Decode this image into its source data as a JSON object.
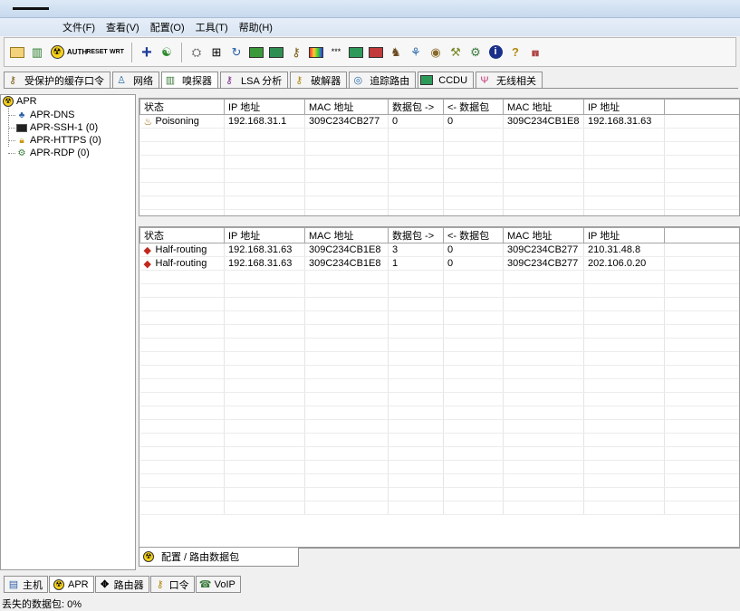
{
  "menu": [
    "文件(F)",
    "查看(V)",
    "配置(O)",
    "工具(T)",
    "帮助(H)"
  ],
  "toolbar": [
    "folder-icon",
    "network-card-icon",
    "nuclear-icon",
    "auth-icon",
    "reset-icon",
    "wrt-icon",
    "plus-icon",
    "globe-icon",
    "sniffer-icon",
    "route-icon",
    "refresh-icon",
    "chart-icon",
    "hash-icon",
    "lock-key-icon",
    "rainbow-icon",
    "dots-icon",
    "card-icon",
    "cpu-icon",
    "bucket-icon",
    "network-icon",
    "disc-icon",
    "tools-icon",
    "gear-icon",
    "info-icon",
    "help-icon",
    "tower-icon"
  ],
  "tabs": [
    {
      "label": "受保护的缓存口令",
      "icon": "key-user-icon"
    },
    {
      "label": "网络",
      "icon": "network-icon"
    },
    {
      "label": "嗅探器",
      "icon": "sniffer-icon"
    },
    {
      "label": "LSA 分析",
      "icon": "lsa-icon"
    },
    {
      "label": "破解器",
      "icon": "cracker-icon"
    },
    {
      "label": "追踪路由",
      "icon": "traceroute-icon"
    },
    {
      "label": "CCDU",
      "icon": "ccdu-icon"
    },
    {
      "label": "无线相关",
      "icon": "wireless-icon"
    }
  ],
  "active_tab_index": 2,
  "tree": {
    "root": "APR",
    "children": [
      "APR-DNS",
      "APR-SSH-1 (0)",
      "APR-HTTPS (0)",
      "APR-RDP (0)"
    ]
  },
  "grid_top": {
    "headers": [
      "状态",
      "IP 地址",
      "MAC 地址",
      "数据包 ->",
      "<- 数据包",
      "MAC 地址",
      "IP 地址",
      ""
    ],
    "rows": [
      [
        "Poisoning",
        "192.168.31.1",
        "309C234CB277",
        "0",
        "0",
        "309C234CB1E8",
        "192.168.31.63",
        ""
      ]
    ]
  },
  "grid_bottom": {
    "headers": [
      "状态",
      "IP 地址",
      "MAC 地址",
      "数据包 ->",
      "<- 数据包",
      "MAC 地址",
      "IP 地址",
      ""
    ],
    "rows": [
      [
        "Half-routing",
        "192.168.31.63",
        "309C234CB1E8",
        "3",
        "0",
        "309C234CB277",
        "210.31.48.8",
        ""
      ],
      [
        "Half-routing",
        "192.168.31.63",
        "309C234CB1E8",
        "1",
        "0",
        "309C234CB277",
        "202.106.0.20",
        ""
      ]
    ]
  },
  "subtab": "配置 / 路由数据包",
  "view_tabs": [
    {
      "label": "主机",
      "icon": "host-icon"
    },
    {
      "label": "APR",
      "icon": "apr-icon"
    },
    {
      "label": "路由器",
      "icon": "router-icon"
    },
    {
      "label": "口令",
      "icon": "password-icon"
    },
    {
      "label": "VoIP",
      "icon": "voip-icon"
    }
  ],
  "active_view_tab_index": 1,
  "status": "丢失的数据包:  0%"
}
